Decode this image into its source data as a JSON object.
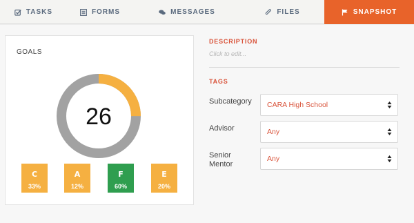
{
  "tabs": [
    {
      "label": "TASKS",
      "icon": "check-square-icon"
    },
    {
      "label": "FORMS",
      "icon": "list-icon"
    },
    {
      "label": "MESSAGES",
      "icon": "chat-bubbles-icon"
    },
    {
      "label": "FILES",
      "icon": "paperclip-icon"
    },
    {
      "label": "SNAPSHOT",
      "icon": "flag-icon",
      "active": true
    }
  ],
  "goals": {
    "title": "GOALS",
    "value": "26",
    "progress": 0.25,
    "colors": {
      "progress": "#f5b041",
      "track": "#a2a2a2"
    },
    "grades": [
      {
        "letter": "C",
        "percent": "33%",
        "color": "#f5b041"
      },
      {
        "letter": "A",
        "percent": "12%",
        "color": "#f5b041"
      },
      {
        "letter": "F",
        "percent": "60%",
        "color": "#2f9e4f"
      },
      {
        "letter": "E",
        "percent": "20%",
        "color": "#f5b041"
      }
    ]
  },
  "description": {
    "label": "DESCRIPTION",
    "placeholder": "Click to edit..."
  },
  "tags": {
    "label": "TAGS",
    "fields": [
      {
        "label": "Subcategory",
        "value": "CARA High School"
      },
      {
        "label": "Advisor",
        "value": "Any"
      },
      {
        "label": "Senior Mentor",
        "value": "Any"
      }
    ]
  },
  "accent_color": "#e8632a"
}
